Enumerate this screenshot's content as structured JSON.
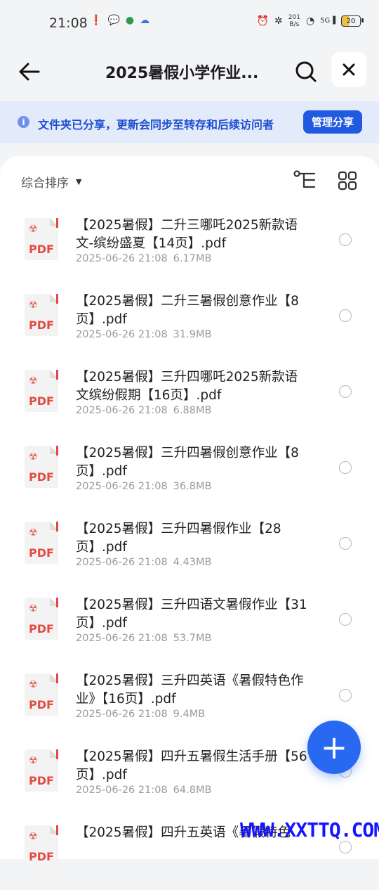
{
  "status_bar": {
    "time": "21:08",
    "net_speed_value": "201",
    "net_speed_unit": "B/s",
    "signal_label": "5G",
    "battery": "20"
  },
  "header": {
    "title": "2025暑假小学作业...",
    "back_icon": "arrow-left-icon",
    "search_icon": "search-icon",
    "close_icon": "close-icon"
  },
  "banner": {
    "text": "文件夹已分享，更新会同步至转存和后续访问者",
    "manage_label": "管理分享"
  },
  "toolbar": {
    "sort_label": "综合排序"
  },
  "files": [
    {
      "name": "【2025暑假】二升三哪吒2025新款语文-缤纷盛夏【14页】.pdf",
      "date": "2025-06-26 21:08",
      "size": "6.17MB"
    },
    {
      "name": "【2025暑假】二升三暑假创意作业【8页】.pdf",
      "date": "2025-06-26 21:08",
      "size": "31.9MB"
    },
    {
      "name": "【2025暑假】三升四哪吒2025新款语文缤纷假期【16页】.pdf",
      "date": "2025-06-26 21:08",
      "size": "6.88MB"
    },
    {
      "name": "【2025暑假】三升四暑假创意作业【8页】.pdf",
      "date": "2025-06-26 21:08",
      "size": "36.8MB"
    },
    {
      "name": "【2025暑假】三升四暑假作业【28页】.pdf",
      "date": "2025-06-26 21:08",
      "size": "4.43MB"
    },
    {
      "name": "【2025暑假】三升四语文暑假作业【31页】.pdf",
      "date": "2025-06-26 21:08",
      "size": "53.7MB"
    },
    {
      "name": "【2025暑假】三升四英语《暑假特色作业》【16页】.pdf",
      "date": "2025-06-26 21:08",
      "size": "9.4MB"
    },
    {
      "name": "【2025暑假】四升五暑假生活手册【56页】.pdf",
      "date": "2025-06-26 21:08",
      "size": "64.8MB"
    },
    {
      "name": "【2025暑假】四升五英语《暑假特色",
      "date": "",
      "size": ""
    }
  ],
  "file_type_label": "PDF",
  "fab_label": "+",
  "watermark": "WWW.XXTTQ.COM",
  "colors": {
    "accent": "#2159e0",
    "banner_bg": "#e3ebfb",
    "pdf_red": "#e24b40"
  }
}
